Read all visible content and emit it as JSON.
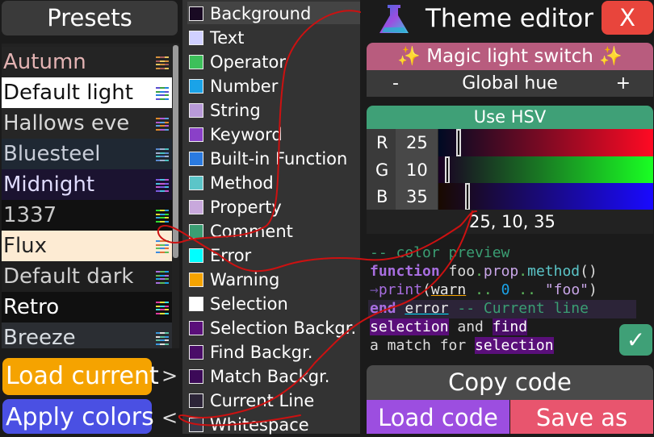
{
  "presets": {
    "title": "Presets",
    "items": [
      {
        "label": "Autumn",
        "bg": "#242424",
        "color": "#e3b3b3",
        "swatch": [
          "#d4903c",
          "#a75a5a",
          "#e8c45c"
        ]
      },
      {
        "label": "Default light",
        "bg": "#ffffff",
        "color": "#111111",
        "swatch": [
          "#5a4cd0",
          "#3aa040",
          "#2080e0"
        ]
      },
      {
        "label": "Hallows eve",
        "bg": "#262626",
        "color": "#d8d8d8",
        "swatch": [
          "#e08a2a",
          "#b45ad0",
          "#5aa0e0"
        ]
      },
      {
        "label": "Bluesteel",
        "bg": "#1f2833",
        "color": "#c8cdd8",
        "swatch": [
          "#5a8ad0",
          "#a0b0d0",
          "#4ac0c0"
        ]
      },
      {
        "label": "Midnight",
        "bg": "#1b1330",
        "color": "#e0dcff",
        "swatch": [
          "#7a5ae0",
          "#4ac0e0",
          "#c05ad0"
        ]
      },
      {
        "label": "1337",
        "bg": "#111111",
        "color": "#c8c8c8",
        "swatch": [
          "#30e030",
          "#e0e030",
          "#30a0e0"
        ]
      },
      {
        "label": "Flux",
        "bg": "#fdebd3",
        "color": "#222222",
        "swatch": [
          "#3a8ae0",
          "#e0703a",
          "#5ac05a"
        ]
      },
      {
        "label": "Default dark",
        "bg": "#1f1f1f",
        "color": "#cfcfcf",
        "swatch": [
          "#a86ee0",
          "#5cb85c",
          "#1aa3e8"
        ]
      },
      {
        "label": "Retro",
        "bg": "#101010",
        "color": "#ffffff",
        "swatch": [
          "#e03aa0",
          "#e0e03a",
          "#3ae0e0"
        ]
      },
      {
        "label": "Breeze",
        "bg": "#2b2e33",
        "color": "#d8dde2",
        "swatch": [
          "#3a9ae0",
          "#e0e0e0",
          "#5ac0a0"
        ]
      }
    ],
    "load_current": "Load current",
    "apply_colors": "Apply colors",
    "arrow_right": ">",
    "arrow_left": "<"
  },
  "keys": [
    {
      "label": "Background",
      "color": "#190a23"
    },
    {
      "label": "Text",
      "color": "#d0d0ff"
    },
    {
      "label": "Operator",
      "color": "#3dc05a"
    },
    {
      "label": "Number",
      "color": "#1aa3e8"
    },
    {
      "label": "String",
      "color": "#b89ad8"
    },
    {
      "label": "Keyword",
      "color": "#8a40c8"
    },
    {
      "label": "Built-in Function",
      "color": "#2a7ae0"
    },
    {
      "label": "Method",
      "color": "#5bc5c8"
    },
    {
      "label": "Property",
      "color": "#c8a8dc"
    },
    {
      "label": "Comment",
      "color": "#3a9e73"
    },
    {
      "label": "Error",
      "color": "#00ffff"
    },
    {
      "label": "Warning",
      "color": "#f5a300"
    },
    {
      "label": "Selection",
      "color": "#ffffff"
    },
    {
      "label": "Selection Backgr.",
      "color": "#5a0f7a"
    },
    {
      "label": "Find Backgr.",
      "color": "#4a0d68"
    },
    {
      "label": "Match Backgr.",
      "color": "#3c0a58"
    },
    {
      "label": "Current Line",
      "color": "#2c2438"
    },
    {
      "label": "Whitespace",
      "color": "#3a3a4a"
    }
  ],
  "editor": {
    "title": "Theme editor",
    "close_label": "X",
    "magic_label": "✨ Magic light switch ✨",
    "hue_minus": "-",
    "hue_label": "Global hue",
    "hue_plus": "+",
    "hsv_label": "Use HSV",
    "channels": [
      {
        "label": "R",
        "value": "25"
      },
      {
        "label": "G",
        "value": "10"
      },
      {
        "label": "B",
        "value": "35"
      }
    ],
    "rgb_text": "25, 10, 35",
    "check_label": "✓"
  },
  "preview": {
    "line1": "-- color preview",
    "line2_kw": "function",
    "line2_id": " foo",
    "line2_dot1": ".",
    "line2_prop": "prop",
    "line2_dot2": ".",
    "line2_meth": "method",
    "line2_paren": "()",
    "line3_ws": "→",
    "line3_fn": "print",
    "line3_op1": "(",
    "line3_warn": "warn",
    "line3_sp1": " ",
    "line3_op2": "..",
    "line3_sp2": " ",
    "line3_num": "0",
    "line3_sp3": " ",
    "line3_op3": "..",
    "line3_sp4": " ",
    "line3_str": "\"foo\"",
    "line3_op4": ")",
    "line4_kw": "end",
    "line4_sp": " ",
    "line4_err": "error",
    "line4_comment": " -- Current line",
    "line5_sel": "selection",
    "line5_mid": " and ",
    "line5_find": "find",
    "line6_pre": "a match for ",
    "line6_sel": "selection"
  },
  "bottom": {
    "copy_label": "Copy code",
    "load_label": "Load code",
    "save_label": "Save as"
  },
  "colors": {
    "accent_orange": "#f5a300",
    "accent_blue": "#4a50e3",
    "accent_green": "#3fa077",
    "accent_pink": "#e8556e",
    "accent_purple": "#9c4ee0",
    "close_red": "#e8453c",
    "annotation_red": "#cc1111"
  }
}
